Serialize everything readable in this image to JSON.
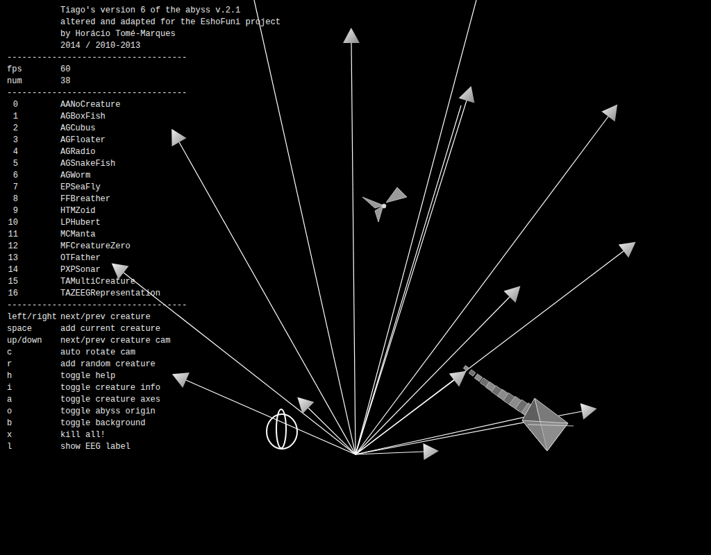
{
  "header": [
    "Tiago's version 6 of the abyss v.2.1",
    "altered and adapted for the EshoFuni project",
    "by Horácio Tomé-Marques",
    "2014 / 2010-2013"
  ],
  "separator": "------------------------------------",
  "stats": [
    {
      "label": "fps",
      "value": "60"
    },
    {
      "label": "num",
      "value": "38"
    }
  ],
  "creatures": [
    {
      "index": "0",
      "name": "AANoCreature"
    },
    {
      "index": "1",
      "name": "AGBoxFish"
    },
    {
      "index": "2",
      "name": "AGCubus"
    },
    {
      "index": "3",
      "name": "AGFloater"
    },
    {
      "index": "4",
      "name": "AGRadio"
    },
    {
      "index": "5",
      "name": "AGSnakeFish"
    },
    {
      "index": "6",
      "name": "AGWorm"
    },
    {
      "index": "7",
      "name": "EPSeaFly"
    },
    {
      "index": "8",
      "name": "FFBreather"
    },
    {
      "index": "9",
      "name": "HTMZoid"
    },
    {
      "index": "10",
      "name": "LPHubert"
    },
    {
      "index": "11",
      "name": "MCManta"
    },
    {
      "index": "12",
      "name": "MFCreatureZero"
    },
    {
      "index": "13",
      "name": "OTFather"
    },
    {
      "index": "14",
      "name": "PXPSonar"
    },
    {
      "index": "15",
      "name": "TAMultiCreature"
    },
    {
      "index": "16",
      "name": "TAZEEGRepresentation"
    }
  ],
  "controls": [
    {
      "key": "left/right",
      "action": "next/prev creature"
    },
    {
      "key": "space",
      "action": "add current creature"
    },
    {
      "key": "up/down",
      "action": "next/prev creature cam"
    },
    {
      "key": "c",
      "action": "auto rotate cam"
    },
    {
      "key": "r",
      "action": "add random creature"
    },
    {
      "key": "h",
      "action": "toggle help"
    },
    {
      "key": "i",
      "action": "toggle creature info"
    },
    {
      "key": "a",
      "action": "toggle creature axes"
    },
    {
      "key": "o",
      "action": "toggle abyss origin"
    },
    {
      "key": "b",
      "action": "toggle background"
    },
    {
      "key": "x",
      "action": "kill all!"
    },
    {
      "key": "l",
      "action": "show EEG label"
    }
  ]
}
